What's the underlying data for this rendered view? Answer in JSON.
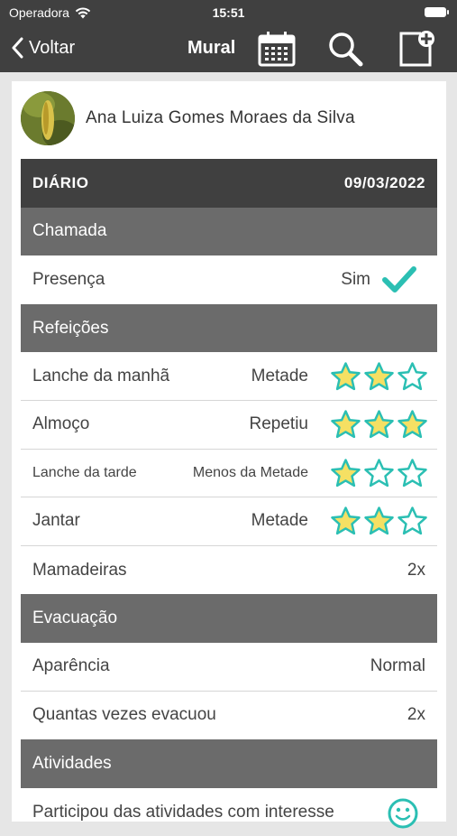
{
  "status_bar": {
    "carrier": "Operadora",
    "time": "15:51"
  },
  "nav": {
    "back_label": "Voltar",
    "title": "Mural"
  },
  "profile": {
    "name": "Ana Luiza Gomes Moraes da Silva"
  },
  "diary": {
    "title": "DIÁRIO",
    "date": "09/03/2022",
    "sections": {
      "chamada": {
        "title": "Chamada",
        "presenca": {
          "label": "Presença",
          "value": "Sim"
        }
      },
      "refeicoes": {
        "title": "Refeições",
        "items": [
          {
            "label": "Lanche da manhã",
            "value": "Metade",
            "rating": 2,
            "max": 3
          },
          {
            "label": "Almoço",
            "value": "Repetiu",
            "rating": 3,
            "max": 3
          },
          {
            "label": "Lanche da tarde",
            "value": "Menos da Metade",
            "rating": 1,
            "max": 3
          },
          {
            "label": "Jantar",
            "value": "Metade",
            "rating": 2,
            "max": 3
          }
        ],
        "mamadeiras": {
          "label": "Mamadeiras",
          "value": "2x"
        }
      },
      "evacuacao": {
        "title": "Evacuação",
        "aparencia": {
          "label": "Aparência",
          "value": "Normal"
        },
        "vezes": {
          "label": "Quantas vezes evacuou",
          "value": "2x"
        }
      },
      "atividades": {
        "title": "Atividades",
        "item": {
          "label": "Participou das atividades com interesse"
        }
      }
    }
  },
  "colors": {
    "header_bar": "#404040",
    "section_bar": "#6b6b6b",
    "star_filled": "#f5e063",
    "star_outline": "#2bbfb3",
    "check": "#2bbfb3"
  }
}
